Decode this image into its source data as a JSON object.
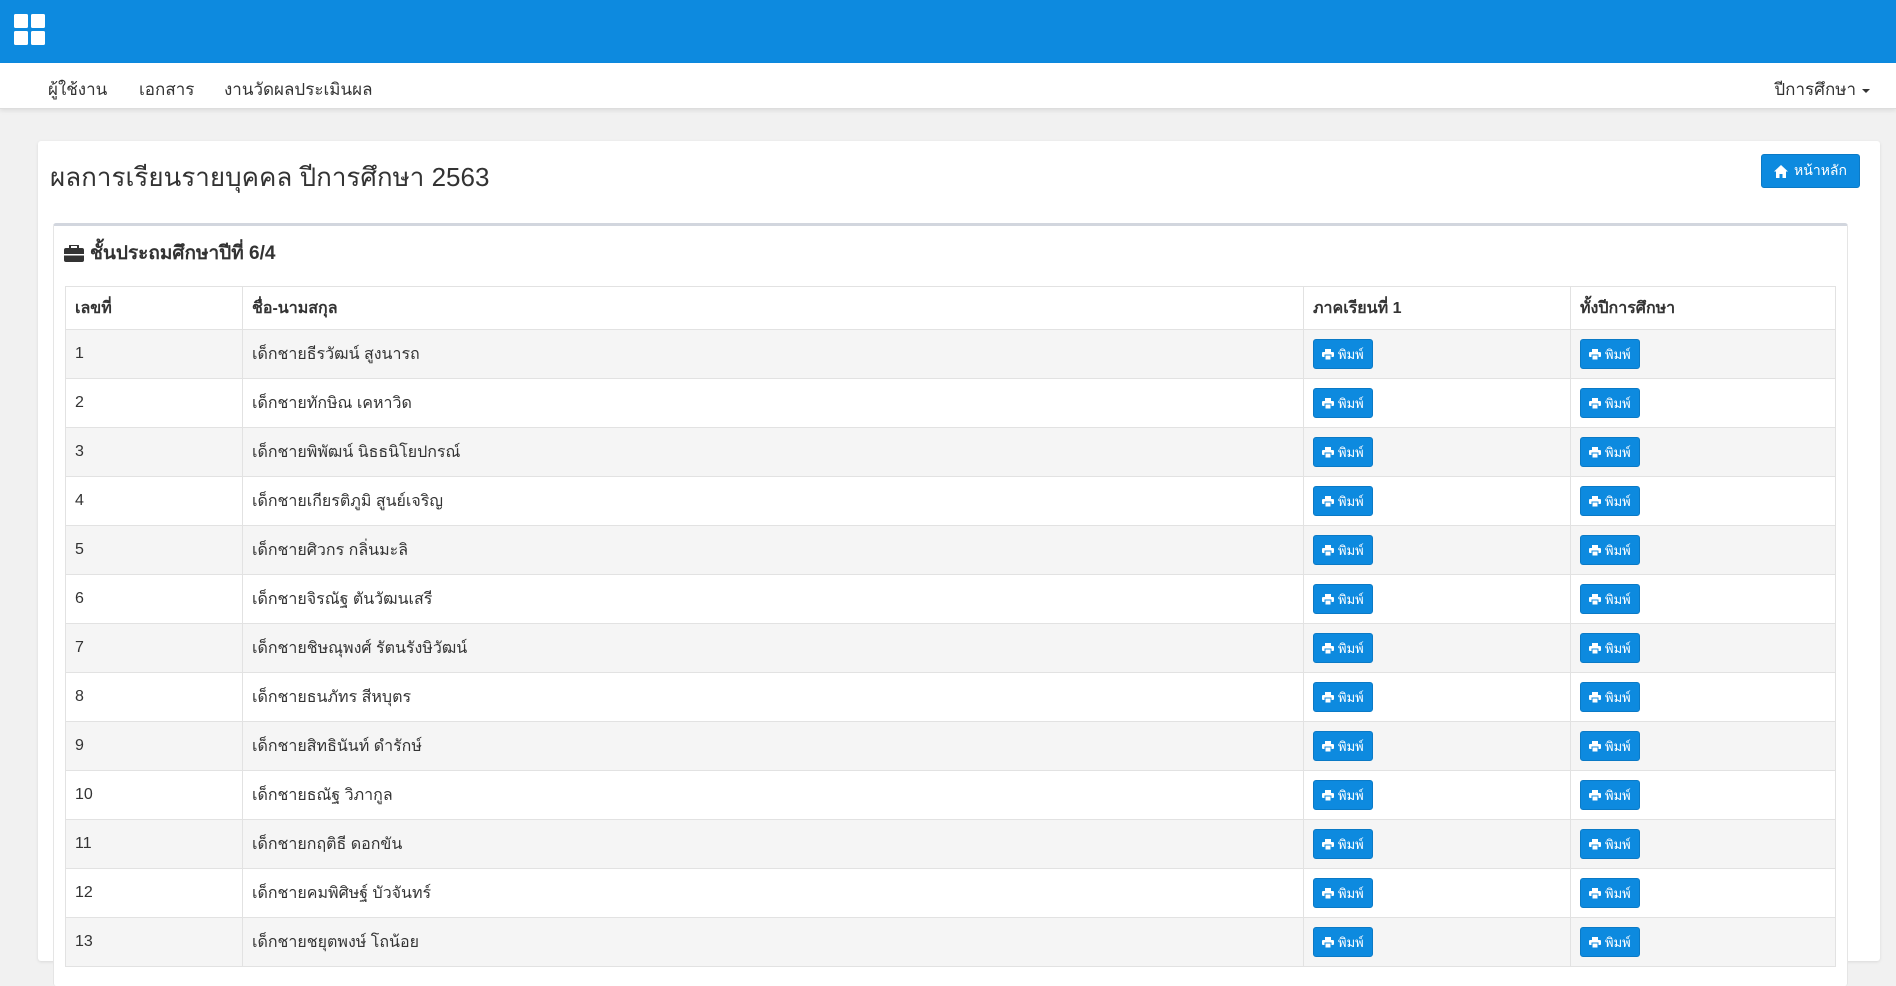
{
  "nav": {
    "items": [
      "ผู้ใช้งาน",
      "เอกสาร",
      "งานวัดผลประเมินผล"
    ],
    "year_menu": "ปีการศึกษา"
  },
  "page": {
    "title": "ผลการเรียนรายบุคคล ปีการศึกษา 2563",
    "home_button": "หน้าหลัก"
  },
  "class": {
    "title": "ชั้นประถมศึกษาปีที่ 6/4"
  },
  "table": {
    "headers": [
      "เลขที่",
      "ชื่อ-นามสกุล",
      "ภาคเรียนที่ 1",
      "ทั้งปีการศึกษา"
    ],
    "print_label": "พิมพ์",
    "rows": [
      {
        "no": "1",
        "name": "เด็กชายธีรวัฒน์ สูงนารถ"
      },
      {
        "no": "2",
        "name": "เด็กชายทักษิณ เคหาวิด"
      },
      {
        "no": "3",
        "name": "เด็กชายพิพัฒน์ นิธธนิโยปกรณ์"
      },
      {
        "no": "4",
        "name": "เด็กชายเกียรติภูมิ สูนย์เจริญ"
      },
      {
        "no": "5",
        "name": "เด็กชายศิวกร กลิ่นมะลิ"
      },
      {
        "no": "6",
        "name": "เด็กชายจิรณัฐ ตันวัฒนเสรี"
      },
      {
        "no": "7",
        "name": "เด็กชายชิษณุพงศ์ รัตนรังษิวัฒน์"
      },
      {
        "no": "8",
        "name": "เด็กชายธนภัทร สีหบุตร"
      },
      {
        "no": "9",
        "name": "เด็กชายสิทธินันท์ ดำรักษ์"
      },
      {
        "no": "10",
        "name": "เด็กชายธณัฐ วิภากูล"
      },
      {
        "no": "11",
        "name": "เด็กชายกฤติธี ดอกขัน"
      },
      {
        "no": "12",
        "name": "เด็กชายคมพิศิษฐ์ บัวจันทร์"
      },
      {
        "no": "13",
        "name": "เด็กชายชยุตพงษ์ โถน้อย"
      }
    ]
  }
}
